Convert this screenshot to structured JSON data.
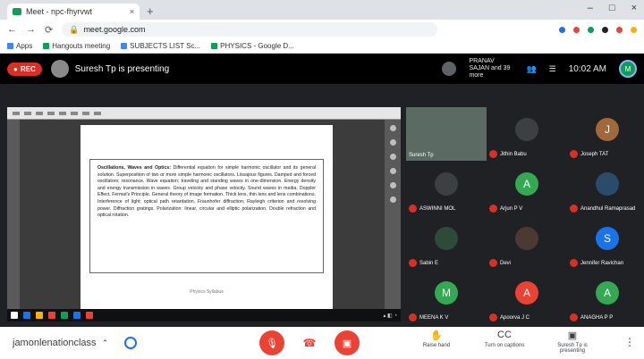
{
  "browser": {
    "tab_title": "Meet - npc-fhyrvwt",
    "tab_close": "×",
    "new_tab": "+",
    "window_controls": [
      "–",
      "□",
      "×"
    ],
    "nav": [
      "←",
      "→",
      "⟳"
    ],
    "url": "meet.google.com",
    "bookmarks": [
      {
        "label": "Apps",
        "color": "#4285f4"
      },
      {
        "label": "Hangouts meeting",
        "color": "#0f9d58"
      },
      {
        "label": "SUBJECTS LIST Sc...",
        "color": "#4285f4"
      },
      {
        "label": "PHYSICS - Google D...",
        "color": "#0f9d58"
      }
    ]
  },
  "meet": {
    "rec_label": "REC",
    "presenting_text": "Suresh Tp is presenting",
    "pinned_text": "PRANAV SAJAN and 39 more",
    "time": "10:02 AM",
    "self_initial": "M",
    "meeting_code": "jamonlenationclass",
    "controls": {
      "mic_icon": "mic-off",
      "hangup_icon": "phone",
      "cam_icon": "camera-off"
    },
    "right_controls": [
      {
        "label": "Raise hand",
        "icon": "✋"
      },
      {
        "label": "Turn on captions",
        "icon": "CC"
      },
      {
        "label": "Suresh Tp is presenting",
        "icon": "▣"
      }
    ],
    "more_icon": "⋮"
  },
  "document": {
    "heading": "Oscillations, Waves and Optics:",
    "body": "Differential equation for simple harmonic oscillator and its general solution. Superposition of two or more simple harmonic oscillators. Lissajous figures. Damped and forced oscillators; resonance. Wave equation; traveling and standing waves in one-dimension. Energy density and energy transmission in waves. Group velocity and phase velocity. Sound waves in media. Doppler Effect. Fermat's Principle. General theory of image formation. Thick lens, thin lens and lens combinations. Interference of light; optical path retardation. Fraunhofer diffraction; Rayleigh criterion and resolving power. Diffraction gratings. Polarization: linear, circular and elliptic polarization. Double refraction and optical rotation.",
    "footer": "Physics Syllabus"
  },
  "participants": [
    {
      "name": "Suresh Tp",
      "initial": "",
      "color": "#5b6b63",
      "video": true
    },
    {
      "name": "Jithin Babu",
      "initial": "",
      "color": "#3c4043",
      "video": false
    },
    {
      "name": "Joseph TAT",
      "initial": "J",
      "color": "#a1683c",
      "video": false
    },
    {
      "name": "ASWINNI MOL",
      "initial": "",
      "color": "#3c4043",
      "video": false
    },
    {
      "name": "Arjun P V",
      "initial": "A",
      "color": "#34a853",
      "video": false
    },
    {
      "name": "Anandhul Ramaprasad",
      "initial": "",
      "color": "#2b4b6b",
      "video": false
    },
    {
      "name": "Sabin E",
      "initial": "",
      "color": "#2e4a3a",
      "video": false
    },
    {
      "name": "Devi",
      "initial": "",
      "color": "#4a3a32",
      "video": false
    },
    {
      "name": "Jennifer Ravichan",
      "initial": "S",
      "color": "#1a73e8",
      "video": false
    },
    {
      "name": "MEENA K V",
      "initial": "M",
      "color": "#34a853",
      "video": false
    },
    {
      "name": "Apoorva J C",
      "initial": "A",
      "color": "#ea4335",
      "video": false
    },
    {
      "name": "ANAGHA P P",
      "initial": "A",
      "color": "#34a853",
      "video": false
    }
  ]
}
